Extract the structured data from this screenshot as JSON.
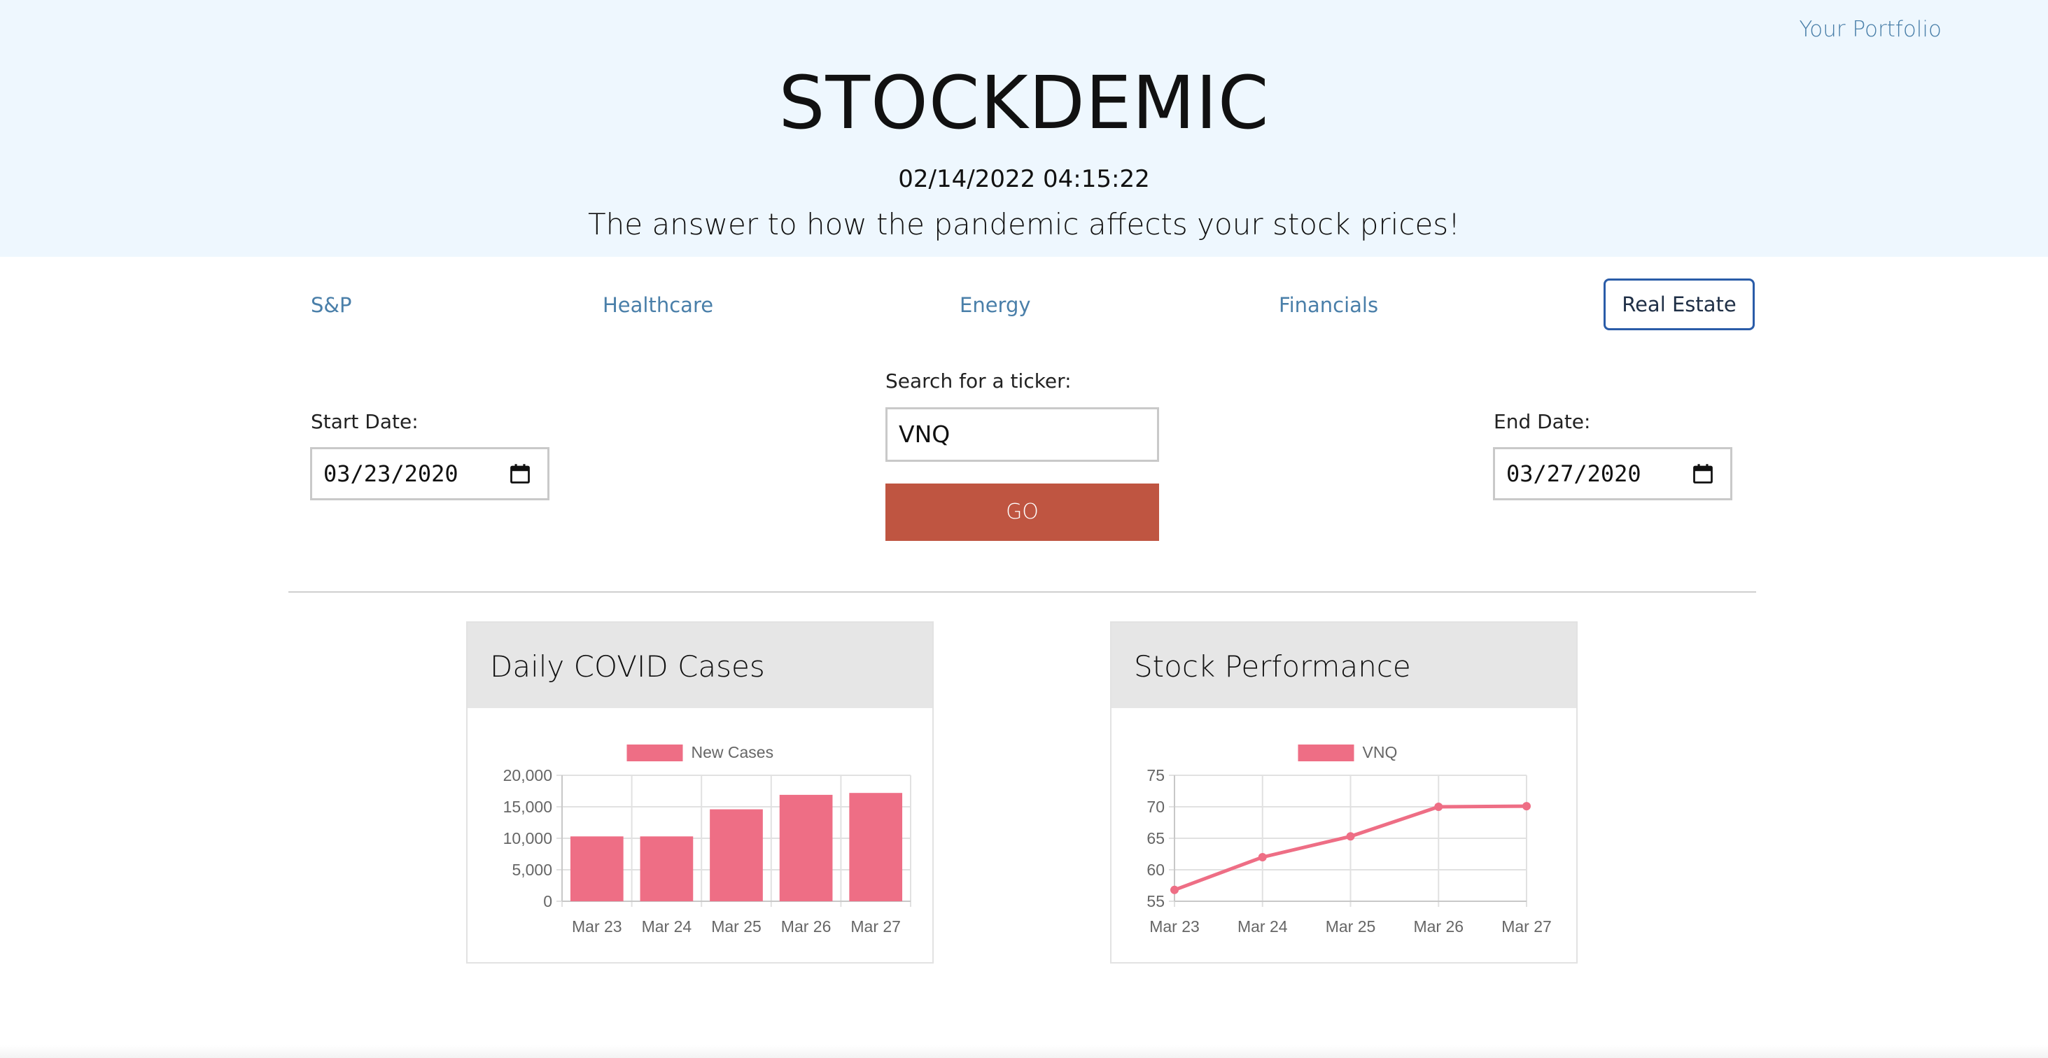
{
  "header": {
    "portfolio_link": "Your Portfolio",
    "brand": "STOCKDEMIC",
    "datetime": "02/14/2022 04:15:22",
    "tagline": "The answer to how the pandemic affects your stock prices!"
  },
  "nav": {
    "items": [
      "S&P",
      "Healthcare",
      "Energy",
      "Financials",
      "Real Estate"
    ],
    "active": "Real Estate"
  },
  "form": {
    "start_label": "Start Date:",
    "start_value": "03/23/2020",
    "ticker_label": "Search for a ticker:",
    "ticker_value": "VNQ",
    "go_label": "GO",
    "end_label": "End Date:",
    "end_value": "03/27/2020"
  },
  "colors": {
    "accent_red": "#bf5541",
    "series_pink": "#ee6e85",
    "link_blue": "#4a7fa9",
    "hero_bg": "#eef7fe"
  },
  "cards": {
    "covid_title": "Daily COVID Cases",
    "stock_title": "Stock Performance"
  },
  "chart_data": [
    {
      "type": "bar",
      "categories": [
        "Mar 23",
        "Mar 24",
        "Mar 25",
        "Mar 26",
        "Mar 27"
      ],
      "series": [
        {
          "name": "New Cases",
          "values": [
            10300,
            10300,
            14600,
            16900,
            17200
          ]
        }
      ],
      "ylim": [
        0,
        20000
      ],
      "yticks": [
        "20,000",
        "15,000",
        "10,000",
        "5,000",
        "0"
      ],
      "ytick_values": [
        20000,
        15000,
        10000,
        5000,
        0
      ],
      "legend": "top",
      "grid": true
    },
    {
      "type": "line",
      "categories": [
        "Mar 23",
        "Mar 24",
        "Mar 25",
        "Mar 26",
        "Mar 27"
      ],
      "series": [
        {
          "name": "VNQ",
          "values": [
            56.8,
            62.0,
            65.3,
            70.0,
            70.1
          ]
        }
      ],
      "ylim": [
        55,
        75
      ],
      "yticks": [
        "75",
        "70",
        "65",
        "60",
        "55"
      ],
      "ytick_values": [
        75,
        70,
        65,
        60,
        55
      ],
      "legend": "top",
      "grid": true
    }
  ]
}
